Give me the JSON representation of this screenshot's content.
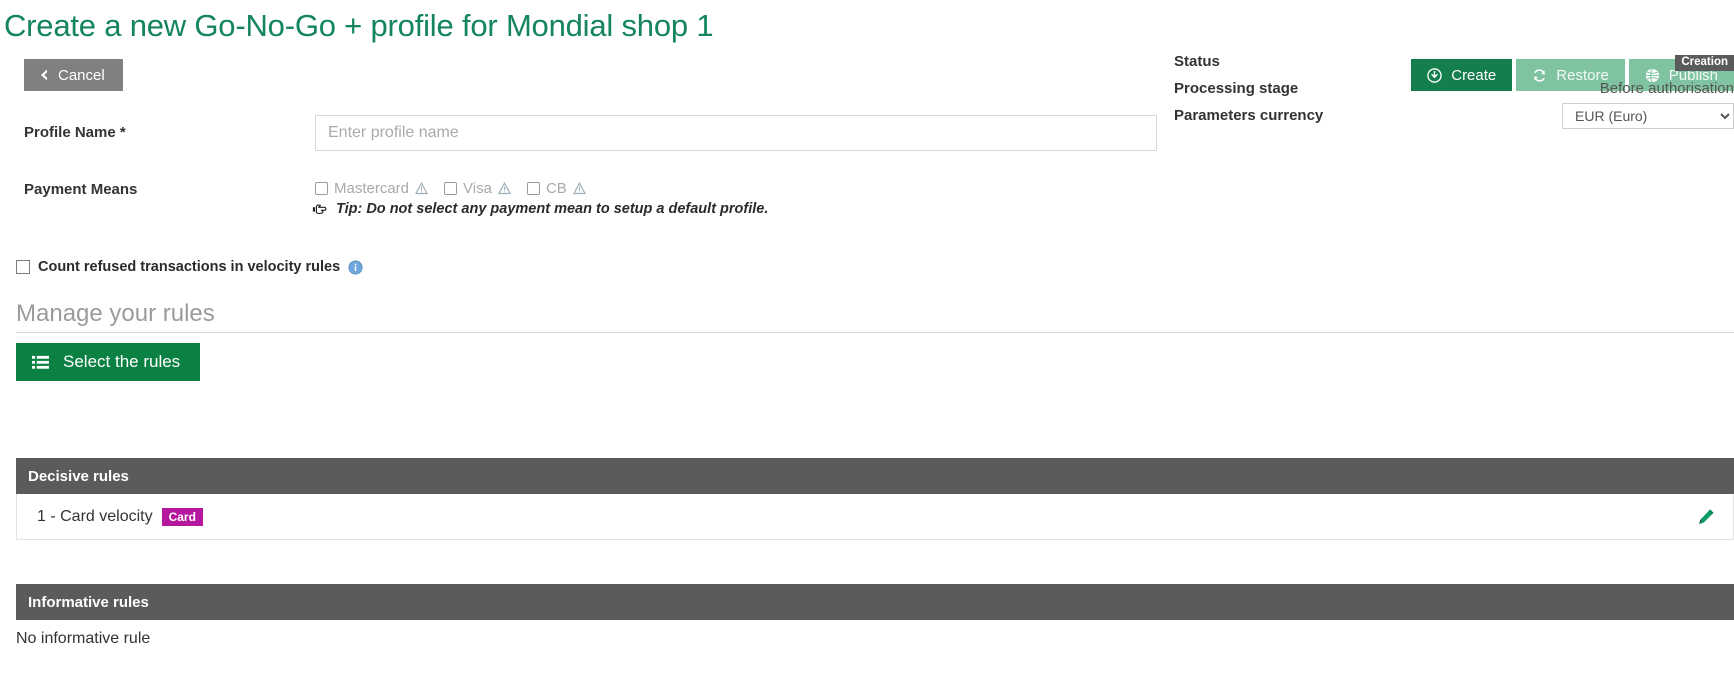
{
  "page": {
    "title": "Create a new Go-No-Go + profile for Mondial shop 1"
  },
  "toolbar": {
    "cancel_label": "Cancel",
    "create_label": "Create",
    "restore_label": "Restore",
    "publish_label": "Publish"
  },
  "form": {
    "profile_name_label": "Profile Name",
    "profile_name_required_mark": "*",
    "profile_name_value": "",
    "profile_name_placeholder": "Enter profile name",
    "payment_means_label": "Payment Means",
    "payment_means": [
      {
        "label": "Mastercard",
        "checked": false
      },
      {
        "label": "Visa",
        "checked": false
      },
      {
        "label": "CB",
        "checked": false
      }
    ],
    "tip_text": "Tip: Do not select any payment mean to setup a default profile.",
    "count_refused_label": "Count refused transactions in velocity rules",
    "count_refused_checked": false
  },
  "status_panel": {
    "status_label": "Status",
    "status_value": "Creation",
    "processing_stage_label": "Processing stage",
    "processing_stage_value": "Before authorisation",
    "parameters_currency_label": "Parameters currency",
    "parameters_currency_value": "EUR (Euro)",
    "parameters_currency_options": [
      "EUR (Euro)"
    ]
  },
  "rules": {
    "section_title": "Manage your rules",
    "select_rules_label": "Select the rules",
    "decisive_header": "Decisive rules",
    "decisive_rows": [
      {
        "name": "1 - Card velocity",
        "badge": "Card"
      }
    ],
    "informative_header": "Informative rules",
    "informative_empty_text": "No informative rule"
  },
  "colors": {
    "brand_green": "#14855f",
    "button_green": "#147e4d",
    "button_green_disabled": "#80c3a1",
    "gray_header": "#5b5b5b",
    "badge_magenta": "#b5179e"
  },
  "icons": {
    "cancel": "chevron-left-icon",
    "create": "download-circle-icon",
    "restore": "refresh-icon",
    "publish": "globe-icon",
    "select_rules": "list-icon",
    "edit": "pencil-icon",
    "info": "info-icon",
    "warning": "warning-triangle-icon",
    "tip": "pointing-hand-icon",
    "dropdown": "chevron-down-icon"
  }
}
